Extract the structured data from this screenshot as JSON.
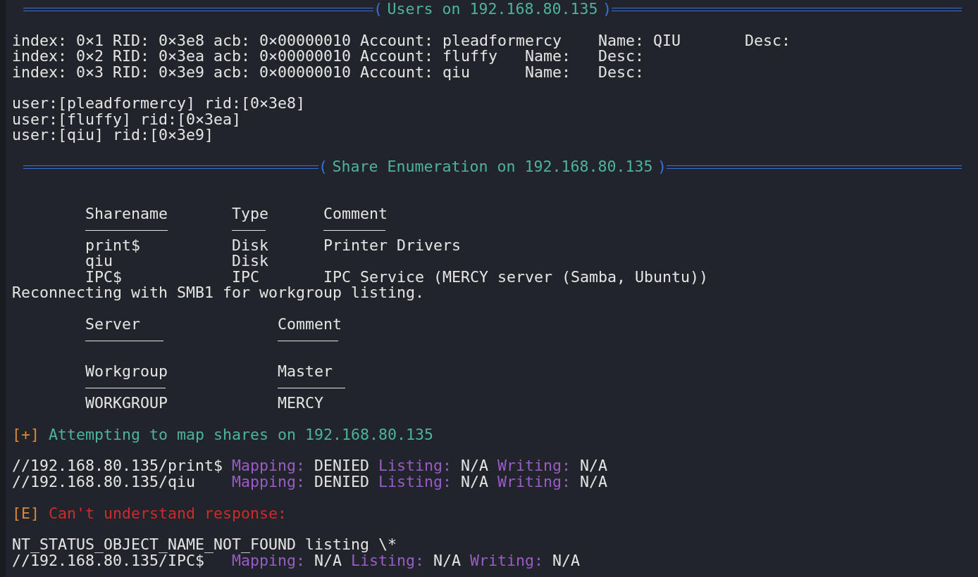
{
  "terminal": {
    "lines": [
      {
        "kind": "banner",
        "open": "(",
        "title": "Users on 192.168.80.135",
        "close": ")"
      },
      {
        "kind": "blank"
      },
      {
        "kind": "text",
        "text": "index: 0×1 RID: 0×3e8 acb: 0×00000010 Account: pleadformercy    Name: QIU       Desc:"
      },
      {
        "kind": "text",
        "text": "index: 0×2 RID: 0×3ea acb: 0×00000010 Account: fluffy   Name:   Desc:"
      },
      {
        "kind": "text",
        "text": "index: 0×3 RID: 0×3e9 acb: 0×00000010 Account: qiu      Name:   Desc:"
      },
      {
        "kind": "blank"
      },
      {
        "kind": "text",
        "text": "user:[pleadformercy] rid:[0×3e8]"
      },
      {
        "kind": "text",
        "text": "user:[fluffy] rid:[0×3ea]"
      },
      {
        "kind": "text",
        "text": "user:[qiu] rid:[0×3e9]"
      },
      {
        "kind": "blank"
      },
      {
        "kind": "banner",
        "open": "(",
        "title": "Share Enumeration on 192.168.80.135",
        "close": ")"
      },
      {
        "kind": "blank"
      },
      {
        "kind": "blank"
      },
      {
        "kind": "table",
        "columns": [
          "Sharename",
          "Type",
          "Comment"
        ],
        "rows": [
          [
            "print$",
            "Disk",
            "Printer Drivers"
          ],
          [
            "qiu",
            "Disk"
          ],
          [
            "IPC$",
            "IPC",
            "IPC Service (MERCY server (Samba, Ubuntu))"
          ]
        ]
      },
      {
        "kind": "text",
        "text": "Reconnecting with SMB1 for workgroup listing."
      },
      {
        "kind": "blank"
      },
      {
        "kind": "table",
        "columns": [
          "Server",
          "Comment"
        ]
      },
      {
        "kind": "blank"
      },
      {
        "kind": "table",
        "columns": [
          "Workgroup",
          "Master"
        ],
        "rows": [
          [
            "WORKGROUP",
            "MERCY"
          ]
        ]
      },
      {
        "kind": "blank"
      },
      {
        "kind": "info",
        "tag": "[+]",
        "message": "Attempting to map shares on 192.168.80.135"
      },
      {
        "kind": "blank"
      },
      {
        "kind": "mapping",
        "path": "//192.168.80.135/print$",
        "fields": [
          {
            "label": "Mapping:",
            "value": "DENIED"
          },
          {
            "label": "Listing:",
            "value": "N/A"
          },
          {
            "label": "Writing:",
            "value": "N/A"
          }
        ]
      },
      {
        "kind": "mapping",
        "path": "//192.168.80.135/qiu",
        "fields": [
          {
            "label": "Mapping:",
            "value": "DENIED"
          },
          {
            "label": "Listing:",
            "value": "N/A"
          },
          {
            "label": "Writing:",
            "value": "N/A"
          }
        ]
      },
      {
        "kind": "blank"
      },
      {
        "kind": "error",
        "tag": "[E]",
        "message": "Can't understand response:"
      },
      {
        "kind": "blank"
      },
      {
        "kind": "text",
        "text": "NT_STATUS_OBJECT_NAME_NOT_FOUND listing \\*"
      },
      {
        "kind": "mapping",
        "path": "//192.168.80.135/IPC$",
        "fields": [
          {
            "label": "Mapping:",
            "value": "N/A"
          },
          {
            "label": "Listing:",
            "value": "N/A"
          },
          {
            "label": "Writing:",
            "value": "N/A"
          }
        ]
      }
    ]
  }
}
